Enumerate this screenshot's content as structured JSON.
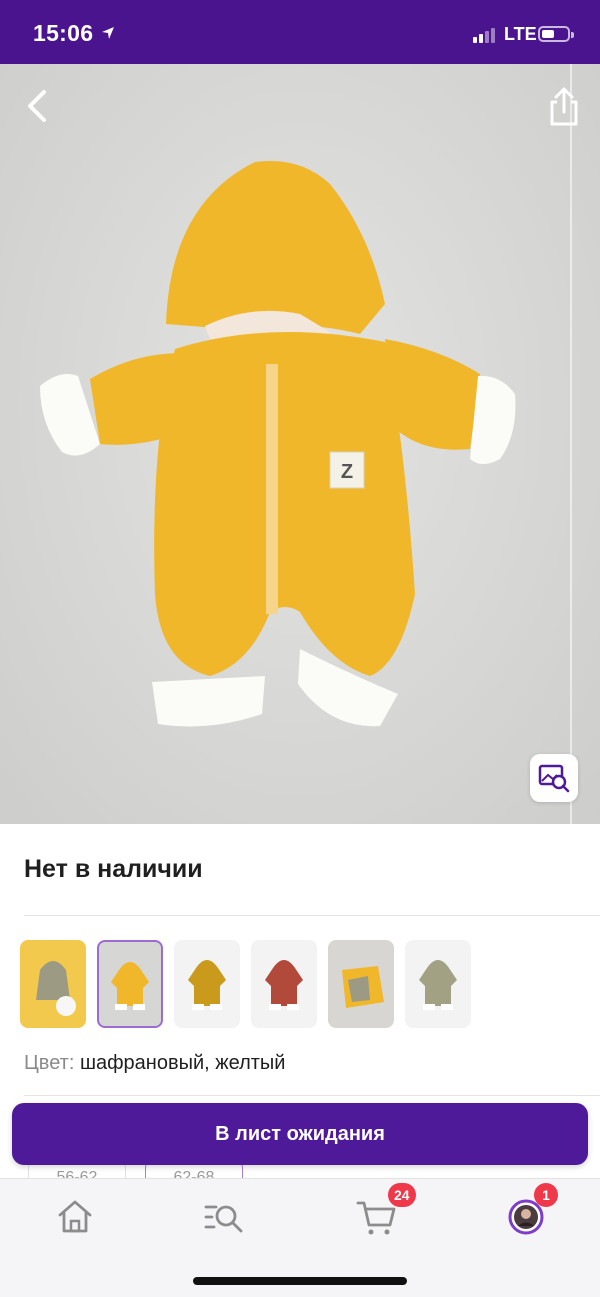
{
  "status_bar": {
    "time": "15:06",
    "network": "LTE",
    "signal_bars": 2,
    "battery_level": 0.4
  },
  "colors": {
    "brand": "#4b148f",
    "button": "#4f1a99",
    "badge": "#f0384b",
    "product": "#f1b72b"
  },
  "product": {
    "availability": "Нет в наличии",
    "color_label": "Цвет:",
    "color_value": "шафрановый, желтый",
    "selected_variant_index": 1
  },
  "sizes": {
    "items": [
      "56-62",
      "62-68"
    ],
    "selected_index": 1
  },
  "actions": {
    "waitlist_label": "В лист ожидания"
  },
  "tab_bar": {
    "items": [
      {
        "icon": "home-icon"
      },
      {
        "icon": "catalog-search-icon"
      },
      {
        "icon": "cart-icon",
        "badge": "24"
      },
      {
        "icon": "profile-avatar-icon",
        "badge": "1"
      }
    ]
  },
  "icons": {
    "back": "chevron-left-icon",
    "share": "share-icon",
    "visual_search": "image-search-icon",
    "location": "location-arrow-icon"
  }
}
